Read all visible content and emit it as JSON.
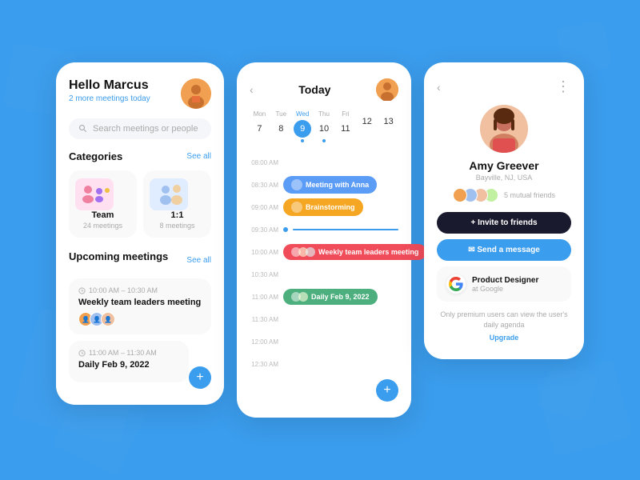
{
  "background": {
    "color": "#3b9ded"
  },
  "card1": {
    "greeting": "Hello ",
    "name": "Marcus",
    "meetings_today": "2 more meetings today",
    "search_placeholder": "Search meetings or people",
    "categories_label": "Categories",
    "see_all": "See all",
    "categories": [
      {
        "name": "Team",
        "count": "24 meetings",
        "color": "#ffe8f0"
      },
      {
        "name": "1:1",
        "count": "8 meetings",
        "color": "#e8f0ff"
      }
    ],
    "upcoming_label": "Upcoming",
    "meetings_label": " meetings",
    "upcoming_see_all": "See all",
    "meetings": [
      {
        "time": "10:00 AM – 10:30 AM",
        "name": "Weekly team leaders meeting"
      },
      {
        "time": "11:00 AM – 11:30 AM",
        "name": "Daily Feb 9, 2022"
      }
    ],
    "fab_label": "+"
  },
  "card2": {
    "title": "Today",
    "nav_back": "‹",
    "nav_forward": "›",
    "days": [
      {
        "label": "Mon",
        "num": "7",
        "dot": false
      },
      {
        "label": "Tue",
        "num": "8",
        "dot": false
      },
      {
        "label": "Wed",
        "num": "9",
        "active": true,
        "dot": true
      },
      {
        "label": "Thu",
        "num": "10",
        "dot": true
      },
      {
        "label": "Fri",
        "num": "11",
        "dot": false
      },
      {
        "label": "",
        "num": "12",
        "dot": false
      },
      {
        "label": "",
        "num": "13",
        "dot": false
      }
    ],
    "timeline": [
      {
        "time": "08:00 AM",
        "event": null
      },
      {
        "time": "08:30 AM",
        "event": {
          "label": "Meeting with Anna",
          "color": "event-blue"
        }
      },
      {
        "time": "09:00 AM",
        "event": {
          "label": "Brainstorming",
          "color": "event-orange"
        }
      },
      {
        "time": "09:30 AM",
        "event": null,
        "now": true
      },
      {
        "time": "10:00 AM",
        "event": {
          "label": "Weekly team leaders meeting",
          "color": "event-red"
        }
      },
      {
        "time": "10:30 AM",
        "event": null
      },
      {
        "time": "11:00 AM",
        "event": {
          "label": "Daily Feb 9, 2022",
          "color": "event-green"
        }
      },
      {
        "time": "11:30 AM",
        "event": null
      },
      {
        "time": "12:00 AM",
        "event": null
      },
      {
        "time": "12:30 AM",
        "event": null
      }
    ],
    "fab_label": "+"
  },
  "card3": {
    "back": "‹",
    "more": "⋮",
    "name": "Amy Greever",
    "location": "Bayville, NJ, USA",
    "mutual_friends": "5 mutual",
    "mutual_label": "friends",
    "invite_label": "+ Invite to friends",
    "message_label": "✉ Send a message",
    "company_role": "Product Designer",
    "company": "at Google",
    "premium_note": "Only premium users can view the user's daily agenda",
    "upgrade_label": "Upgrade"
  }
}
